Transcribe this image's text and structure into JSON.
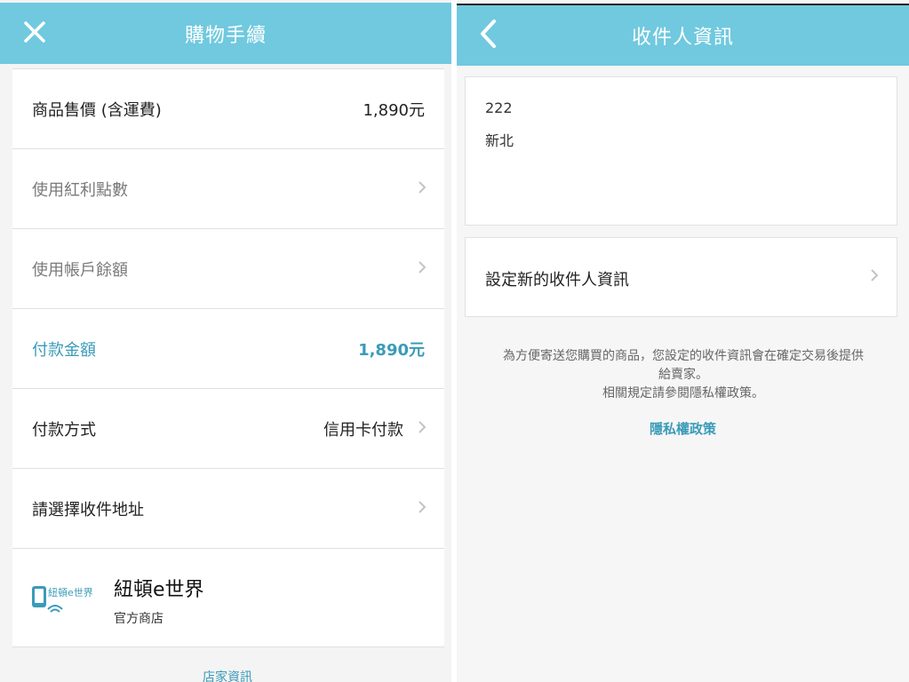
{
  "left": {
    "header": {
      "title": "購物手續",
      "close_icon": "close-icon"
    },
    "rows": {
      "price_label": "商品售價 (含運費)",
      "price_value": "1,890元",
      "bonus_label": "使用紅利點數",
      "balance_label": "使用帳戶餘額",
      "pay_amount_label": "付款金額",
      "pay_amount_value": "1,890元",
      "pay_method_label": "付款方式",
      "pay_method_value": "信用卡付款",
      "address_label": "請選擇收件地址"
    },
    "shop": {
      "logo_text": "紐頓e世界",
      "name": "紐頓e世界",
      "type": "官方商店"
    },
    "footer_link_partial": "店家資訊"
  },
  "right": {
    "header": {
      "title": "收件人資訊",
      "back_icon": "chevron-left-icon"
    },
    "address": {
      "line1": "222",
      "line2": "新北"
    },
    "set_new_label": "設定新的收件人資訊",
    "notice_line1": "為方便寄送您購買的商品，您設定的收件資訊會在確定交易後提供",
    "notice_line2": "給賣家。",
    "notice_line3": "相關規定請參閱隱私權政策。",
    "privacy_link": "隱私權政策"
  },
  "colors": {
    "header_bg": "#70c9df",
    "accent": "#3a9bb8"
  }
}
